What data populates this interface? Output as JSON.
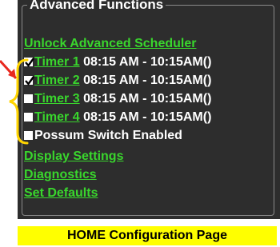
{
  "advanced": {
    "legend": "Advanced Functions",
    "unlock_link": "Unlock Advanced Scheduler",
    "timers": [
      {
        "label": "Timer 1",
        "times": "08:15 AM - 10:15AM()",
        "checked": true
      },
      {
        "label": "Timer 2",
        "times": "08:15 AM - 10:15AM()",
        "checked": true
      },
      {
        "label": "Timer 3",
        "times": "08:15 AM - 10:15AM()",
        "checked": false
      },
      {
        "label": "Timer 4",
        "times": "08:15 AM - 10:15AM()",
        "checked": false
      }
    ],
    "possum_label": "Possum Switch Enabled",
    "possum_checked": false,
    "links": [
      "Display Settings",
      "Diagnostics",
      "Set Defaults"
    ]
  },
  "caption": "HOME Configuration Page",
  "colors": {
    "panel_bg": "#2d2d2d",
    "link_green": "#39d62d",
    "caption_bg": "#ffff00",
    "annotation_bracket": "#ffd400",
    "annotation_arrow": "#e8281e"
  }
}
